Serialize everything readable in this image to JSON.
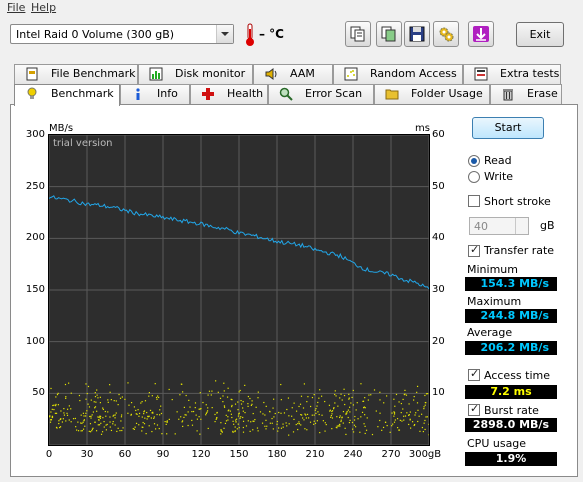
{
  "menu": {
    "file": "File",
    "help": "Help"
  },
  "drive": {
    "selected": "Intel   Raid 0 Volume (300 gB)"
  },
  "temperature": {
    "value": "– °C"
  },
  "toolbar": {
    "exit_label": "Exit"
  },
  "tabs_top": [
    {
      "label": "File Benchmark",
      "icon": "file-benchmark-icon"
    },
    {
      "label": "Disk monitor",
      "icon": "disk-monitor-icon"
    },
    {
      "label": "AAM",
      "icon": "speaker-icon"
    },
    {
      "label": "Random Access",
      "icon": "random-access-icon"
    },
    {
      "label": "Extra tests",
      "icon": "extra-tests-icon"
    }
  ],
  "tabs_bottom": [
    {
      "label": "Benchmark",
      "icon": "lightbulb-icon",
      "active": true
    },
    {
      "label": "Info",
      "icon": "info-icon"
    },
    {
      "label": "Health",
      "icon": "health-cross-icon"
    },
    {
      "label": "Error Scan",
      "icon": "magnifier-icon"
    },
    {
      "label": "Folder Usage",
      "icon": "folder-icon"
    },
    {
      "label": "Erase",
      "icon": "trash-icon"
    }
  ],
  "controls": {
    "start_label": "Start",
    "read_label": "Read",
    "write_label": "Write",
    "mode": "read",
    "short_stroke_label": "Short stroke",
    "short_stroke_checked": false,
    "short_stroke_value": "40",
    "short_stroke_unit": "gB",
    "transfer_rate_label": "Transfer rate",
    "transfer_rate_checked": true,
    "minimum_label": "Minimum",
    "minimum_value": "154.3 MB/s",
    "maximum_label": "Maximum",
    "maximum_value": "244.8 MB/s",
    "average_label": "Average",
    "average_value": "206.2 MB/s",
    "access_time_label": "Access time",
    "access_time_checked": true,
    "access_time_value": "7.2 ms",
    "burst_rate_label": "Burst rate",
    "burst_rate_checked": true,
    "burst_rate_value": "2898.0 MB/s",
    "cpu_usage_label": "CPU usage",
    "cpu_usage_value": "1.9%"
  },
  "chart_data": {
    "type": "line",
    "watermark": "trial version",
    "left_axis_unit": "MB/s",
    "right_axis_unit": "ms",
    "x_ticks": [
      "0",
      "30",
      "60",
      "90",
      "120",
      "150",
      "180",
      "210",
      "240",
      "270",
      "300gB"
    ],
    "y_ticks_left": [
      "300",
      "250",
      "200",
      "150",
      "100",
      "50"
    ],
    "y_ticks_right": [
      "60",
      "50",
      "40",
      "30",
      "20",
      "10"
    ],
    "xlim": [
      0,
      300
    ],
    "ylim_left": [
      0,
      300
    ],
    "ylim_right": [
      0,
      60
    ],
    "grid": true,
    "series": [
      {
        "color": "#22a6e8",
        "x": [
          0,
          10,
          20,
          30,
          40,
          50,
          60,
          70,
          80,
          90,
          100,
          110,
          120,
          130,
          140,
          150,
          160,
          170,
          180,
          190,
          200,
          210,
          220,
          230,
          240,
          250,
          260,
          270,
          280,
          290,
          300
        ],
        "y": [
          240,
          238,
          236,
          233,
          232,
          230,
          227,
          224,
          222,
          220,
          218,
          216,
          214,
          211,
          209,
          205,
          203,
          200,
          197,
          195,
          193,
          189,
          186,
          183,
          176,
          170,
          167,
          165,
          160,
          157,
          151
        ]
      }
    ],
    "access_scatter": {
      "color": "#e6e600",
      "note_range_ms": [
        2,
        13
      ],
      "mean_ms": 7.2
    }
  }
}
